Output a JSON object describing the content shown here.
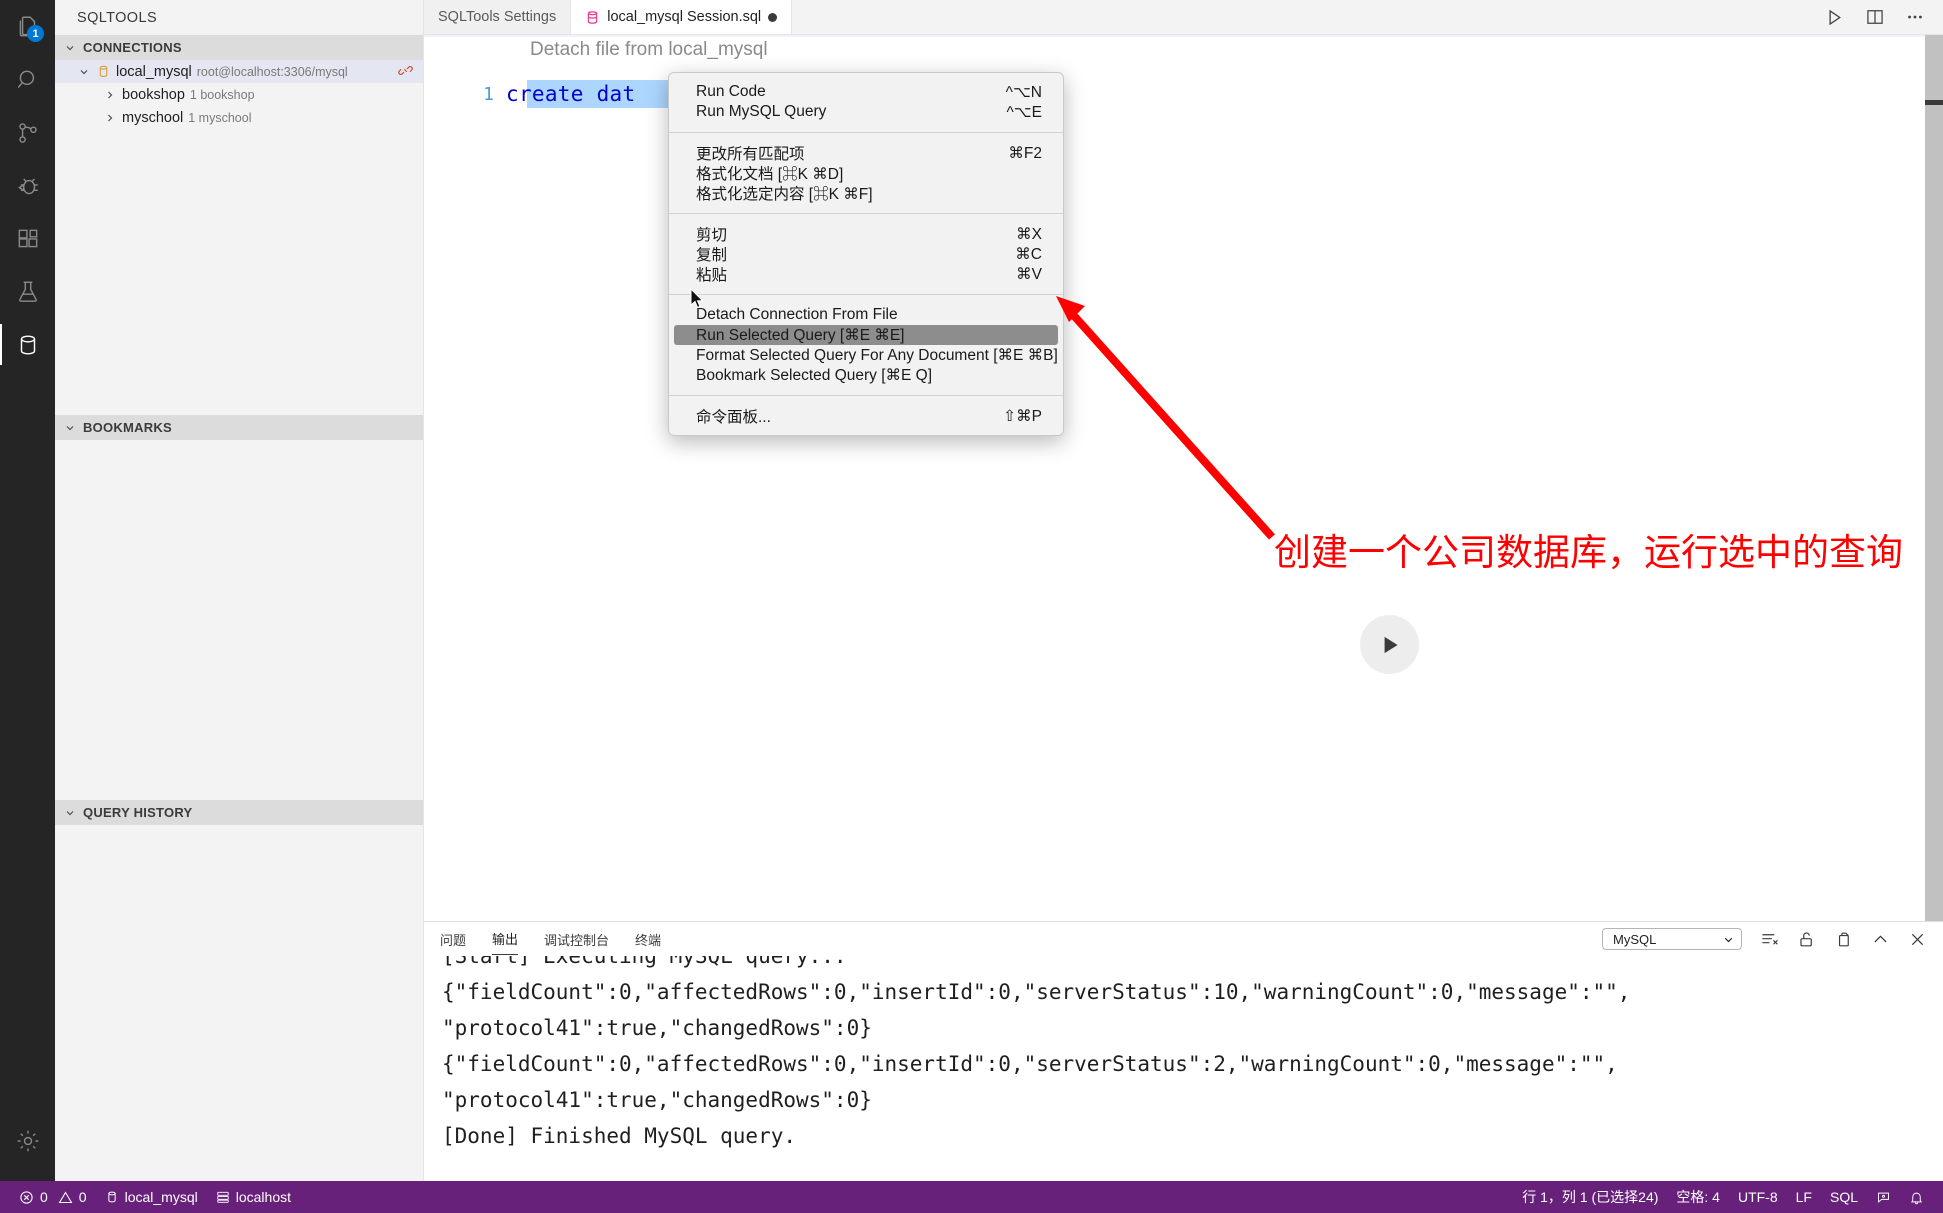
{
  "activity_bar": {
    "items": [
      {
        "name": "explorer",
        "icon": "files-icon",
        "badge": "1",
        "active": false
      },
      {
        "name": "search",
        "icon": "search-icon",
        "badge": "",
        "active": false
      },
      {
        "name": "source-control",
        "icon": "source-control-icon",
        "badge": "",
        "active": false
      },
      {
        "name": "run-and-debug",
        "icon": "debug-icon",
        "badge": "",
        "active": false
      },
      {
        "name": "extensions",
        "icon": "extensions-icon",
        "badge": "",
        "active": false
      },
      {
        "name": "testing",
        "icon": "beaker-icon",
        "badge": "",
        "active": false
      },
      {
        "name": "sqltools",
        "icon": "database-icon",
        "badge": "",
        "active": true
      }
    ],
    "settings": {
      "name": "manage",
      "icon": "gear-icon"
    }
  },
  "sidebar": {
    "title": "SQLTOOLS",
    "sections": [
      {
        "label": "CONNECTIONS",
        "expanded": true
      },
      {
        "label": "BOOKMARKS",
        "expanded": true
      },
      {
        "label": "QUERY HISTORY",
        "expanded": true
      }
    ],
    "connections": [
      {
        "label": "local_mysql",
        "description": "root@localhost:3306/mysql",
        "icon": "database-icon",
        "action_icon": "disconnect-icon",
        "selected": true,
        "expanded": true,
        "depth": 0
      },
      {
        "label": "bookshop",
        "description": "1 bookshop",
        "icon": "",
        "action_icon": "",
        "selected": false,
        "expanded": false,
        "depth": 1
      },
      {
        "label": "myschool",
        "description": "1 myschool",
        "icon": "",
        "action_icon": "",
        "selected": false,
        "expanded": false,
        "depth": 1
      }
    ]
  },
  "tabs": [
    {
      "label": "SQLTools Settings",
      "icon": "",
      "dirty": false,
      "active": false
    },
    {
      "label": "local_mysql Session.sql",
      "icon": "sql-file-icon",
      "dirty": true,
      "active": true
    }
  ],
  "tab_actions": [
    {
      "name": "run-button",
      "icon": "play-icon"
    },
    {
      "name": "split-editor-button",
      "icon": "split-editor-icon"
    },
    {
      "name": "more-actions-button",
      "icon": "ellipsis-icon"
    }
  ],
  "editor": {
    "codelens": "Detach file from local_mysql",
    "line_number": "1",
    "code_text": "create dat",
    "play_overlay_icon": "play-icon"
  },
  "context_menu": {
    "groups": [
      {
        "items": [
          {
            "label": "Run Code",
            "shortcut": "^⌥N",
            "highlight": false
          },
          {
            "label": "Run MySQL Query",
            "shortcut": "^⌥E",
            "highlight": false
          }
        ]
      },
      {
        "items": [
          {
            "label": "更改所有匹配项",
            "shortcut": "⌘F2",
            "highlight": false
          },
          {
            "label": "格式化文档 [⌘K ⌘D]",
            "shortcut": "",
            "highlight": false
          },
          {
            "label": "格式化选定内容 [⌘K ⌘F]",
            "shortcut": "",
            "highlight": false
          }
        ]
      },
      {
        "items": [
          {
            "label": "剪切",
            "shortcut": "⌘X",
            "highlight": false
          },
          {
            "label": "复制",
            "shortcut": "⌘C",
            "highlight": false
          },
          {
            "label": "粘贴",
            "shortcut": "⌘V",
            "highlight": false
          }
        ]
      },
      {
        "items": [
          {
            "label": "Detach Connection From File",
            "shortcut": "",
            "highlight": false
          },
          {
            "label": "Run Selected Query [⌘E ⌘E]",
            "shortcut": "",
            "highlight": true
          },
          {
            "label": "Format Selected Query For Any Document [⌘E ⌘B]",
            "shortcut": "",
            "highlight": false
          },
          {
            "label": "Bookmark Selected Query [⌘E Q]",
            "shortcut": "",
            "highlight": false
          }
        ]
      },
      {
        "items": [
          {
            "label": "命令面板...",
            "shortcut": "⇧⌘P",
            "highlight": false
          }
        ]
      }
    ]
  },
  "annotation": {
    "text": "创建一个公司数据库，运行选中的查询",
    "color": "#ff0000"
  },
  "panel": {
    "tabs": [
      {
        "label": "问题",
        "active": false
      },
      {
        "label": "输出",
        "active": true
      },
      {
        "label": "调试控制台",
        "active": false
      },
      {
        "label": "终端",
        "active": false
      }
    ],
    "channel_select": {
      "value": "MySQL",
      "icon": "chevron-down-icon"
    },
    "actions": [
      {
        "name": "clear-output-button",
        "icon": "clear-output-icon"
      },
      {
        "name": "lock-scroll-button",
        "icon": "unlock-icon"
      },
      {
        "name": "open-in-editor-button",
        "icon": "open-editor-icon"
      },
      {
        "name": "maximize-panel-button",
        "icon": "chevron-up-icon"
      },
      {
        "name": "close-panel-button",
        "icon": "close-icon"
      }
    ],
    "output_lines": [
      "[Start] Executing MySQL query...",
      "{\"fieldCount\":0,\"affectedRows\":0,\"insertId\":0,\"serverStatus\":10,\"warningCount\":0,\"message\":\"\",",
      "\"protocol41\":true,\"changedRows\":0}",
      "{\"fieldCount\":0,\"affectedRows\":0,\"insertId\":0,\"serverStatus\":2,\"warningCount\":0,\"message\":\"\",",
      "\"protocol41\":true,\"changedRows\":0}",
      "[Done] Finished MySQL query."
    ]
  },
  "status_bar": {
    "background": "#68217a",
    "left": [
      {
        "name": "problems",
        "icon": "error-icon",
        "label": "0",
        "second_icon": "warning-icon",
        "second_label": "0"
      },
      {
        "name": "sqltools-connection",
        "icon": "database-icon",
        "label": "local_mysql",
        "second_icon": "",
        "second_label": ""
      },
      {
        "name": "remote-host",
        "icon": "server-icon",
        "label": "localhost",
        "second_icon": "",
        "second_label": ""
      }
    ],
    "right": [
      {
        "name": "editor-position",
        "label": "行 1，列 1 (已选择24)"
      },
      {
        "name": "indentation",
        "label": "空格: 4"
      },
      {
        "name": "encoding",
        "label": "UTF-8"
      },
      {
        "name": "eol",
        "label": "LF"
      },
      {
        "name": "language-mode",
        "label": "SQL"
      },
      {
        "name": "feedback",
        "label": ""
      },
      {
        "name": "notifications",
        "label": ""
      }
    ]
  }
}
